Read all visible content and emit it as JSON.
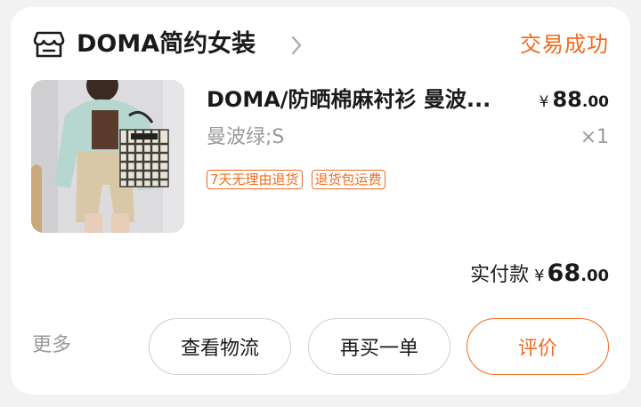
{
  "store": {
    "name": "DOMA简约女装",
    "order_status": "交易成功"
  },
  "item": {
    "title": "DOMA/防晒棉麻衬衫 曼波...",
    "price_currency": "¥",
    "price_int": "88",
    "price_dec": ".00",
    "sku": "曼波绿;S",
    "quantity": "×1",
    "tags": [
      "7天无理由退货",
      "退货包运费"
    ]
  },
  "payment": {
    "label": "实付款",
    "currency": "¥",
    "amount_int": "68",
    "amount_dec": ".00"
  },
  "footer": {
    "more_label": "更多",
    "buttons": {
      "logistics": "查看物流",
      "rebuy": "再买一单",
      "review": "评价"
    }
  },
  "colors": {
    "accent": "#f26b1d",
    "text": "#1a1a1a",
    "muted": "#9a9a9a",
    "background": "#f2f2f2"
  },
  "icons": {
    "store": "store-icon",
    "chevron": "chevron-right-icon"
  }
}
